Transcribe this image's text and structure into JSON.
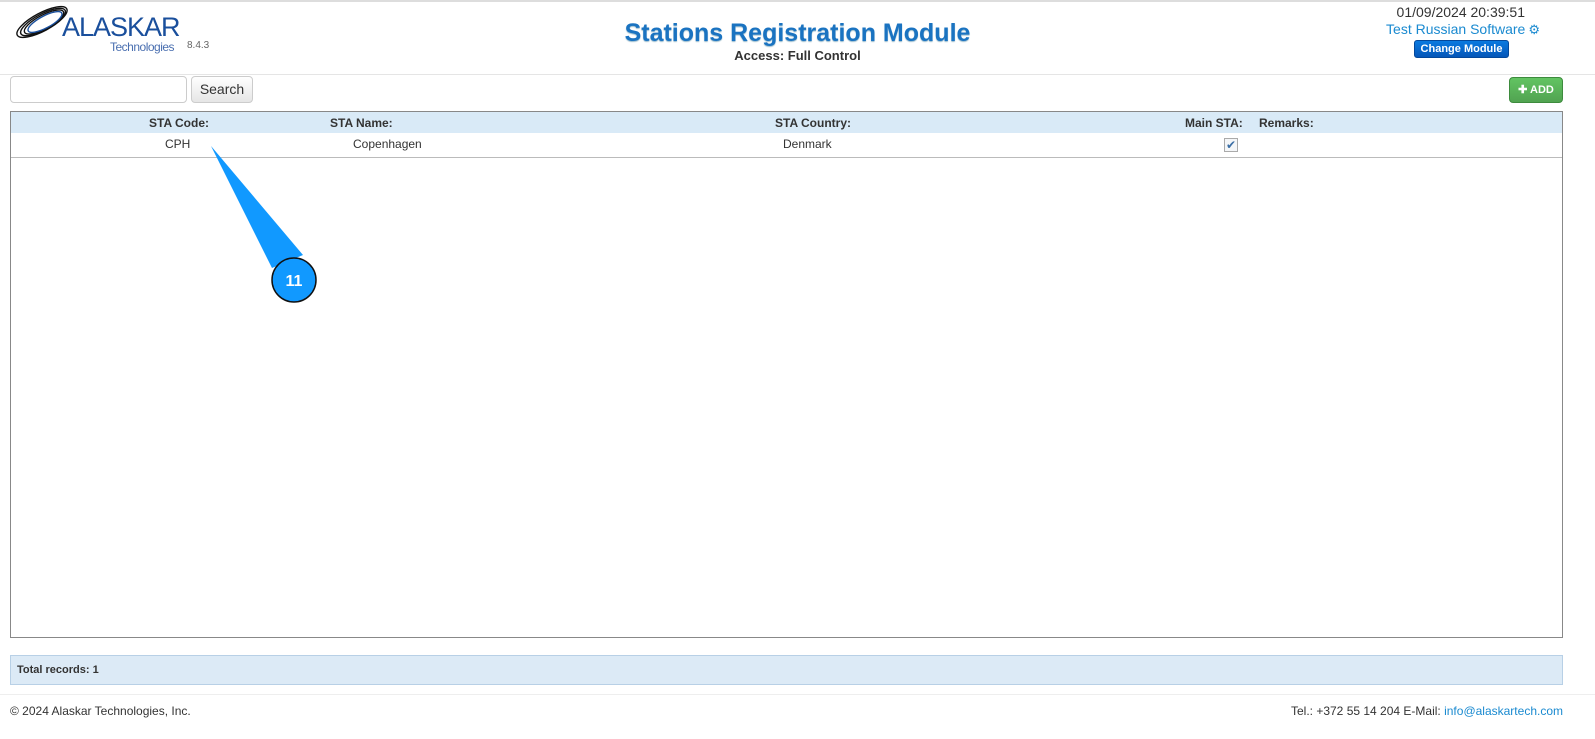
{
  "header": {
    "logo_word": "ALASKAR",
    "logo_sub": "Technologies",
    "version": "8.4.3",
    "title": "Stations Registration Module",
    "access": "Access: Full Control",
    "datetime": "01/09/2024 20:39:51",
    "user": "Test Russian Software",
    "change_module": "Change Module"
  },
  "toolbar": {
    "search_value": "",
    "search_label": "Search",
    "add_label": "ADD"
  },
  "table": {
    "columns": [
      "STA Code:",
      "STA Name:",
      "STA Country:",
      "Main STA:",
      "Remarks:"
    ],
    "rows": [
      {
        "code": "CPH",
        "name": "Copenhagen",
        "country": "Denmark",
        "main": true,
        "remarks": ""
      }
    ]
  },
  "callout": {
    "number": "11"
  },
  "summary": {
    "total": "Total records: 1"
  },
  "footer": {
    "copyright": "© 2024 Alaskar Technologies, Inc.",
    "contact": "Tel.: +372 55 14 204 E-Mail:",
    "email": "info@alaskartech.com"
  },
  "colors": {
    "accent": "#1a73c1",
    "add": "#51a351",
    "callout": "#1199ff"
  }
}
